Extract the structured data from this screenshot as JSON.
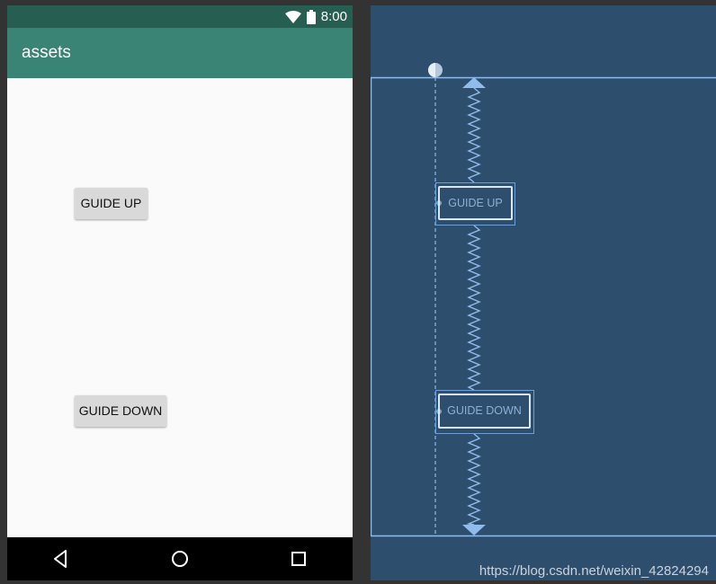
{
  "status_bar": {
    "time": "8:00",
    "icons": [
      "wifi-icon",
      "battery-icon"
    ],
    "color": "#265e51"
  },
  "app_bar": {
    "title": "assets",
    "color": "#3a8476"
  },
  "buttons": {
    "guide_up": "GUIDE UP",
    "guide_down": "GUIDE DOWN"
  },
  "nav_bar": {
    "icons": [
      "back-icon",
      "home-icon",
      "recents-icon"
    ]
  },
  "blueprint": {
    "background": "#2e4e6e",
    "accent": "#6e9ed6",
    "buttons": {
      "guide_up": "GUIDE UP",
      "guide_down": "GUIDE DOWN"
    }
  },
  "watermark": "https://blog.csdn.net/weixin_42824294"
}
